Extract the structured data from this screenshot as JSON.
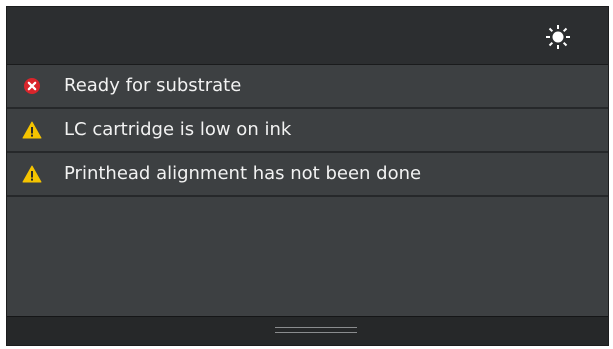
{
  "header": {
    "brightness_icon": "brightness-sun-icon"
  },
  "alerts": [
    {
      "text": "Ready for substrate",
      "severity": "error",
      "icon": "error-x-icon",
      "color": "#d9252b"
    },
    {
      "text": "LC cartridge is low on ink",
      "severity": "warning",
      "icon": "warning-triangle-icon",
      "color": "#f5c400"
    },
    {
      "text": "Printhead alignment has not been done",
      "severity": "warning",
      "icon": "warning-triangle-icon",
      "color": "#f5c400"
    }
  ],
  "footer": {
    "handle_icon": "drawer-handle-icon"
  }
}
